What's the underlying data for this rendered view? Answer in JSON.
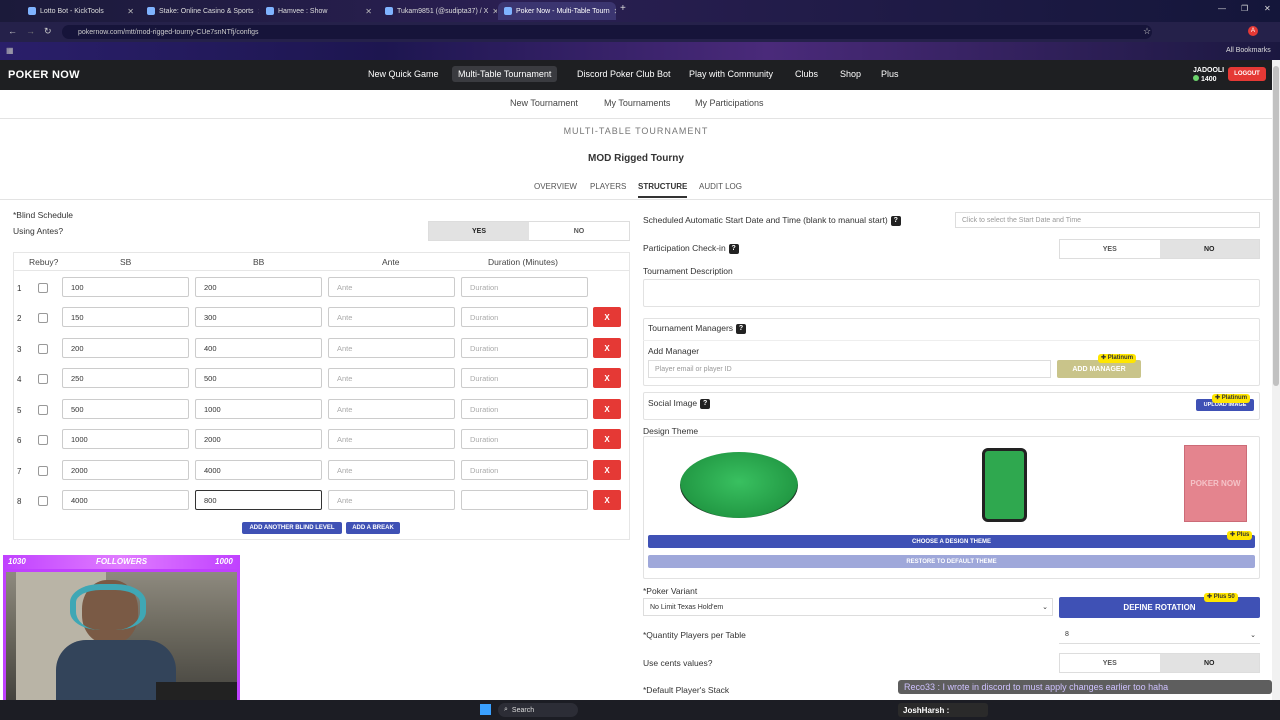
{
  "browser": {
    "tabs": [
      {
        "label": "Lotto Bot - KickTools"
      },
      {
        "label": "Stake: Online Casino & Sports"
      },
      {
        "label": "Hamvee : Show"
      },
      {
        "label": "Tukam9851 (@sudipta37) / X"
      },
      {
        "label": "Poker Now - Multi-Table Tourn"
      }
    ],
    "url": "pokernow.com/mtt/mod-rigged-tourny-CUe7snNTfj/configs",
    "bookmarks_label": "All Bookmarks"
  },
  "header": {
    "logo": "POKER NOW",
    "nav": [
      "New Quick Game",
      "Multi-Table Tournament",
      "Discord Poker Club Bot",
      "Play with Community",
      "Clubs",
      "Shop",
      "Plus"
    ],
    "username": "JADOOLI",
    "chips": "1400",
    "logout": "LOGOUT"
  },
  "subnav": [
    "New Tournament",
    "My Tournaments",
    "My Participations"
  ],
  "page": {
    "section": "MULTI-TABLE TOURNAMENT",
    "name": "MOD Rigged Tourny",
    "tabs": [
      "OVERVIEW",
      "PLAYERS",
      "STRUCTURE",
      "AUDIT LOG"
    ]
  },
  "blind": {
    "schedule_label": "*Blind Schedule",
    "antes_label": "Using Antes?",
    "yes": "YES",
    "no": "NO",
    "headers": [
      "Rebuy?",
      "SB",
      "BB",
      "Ante",
      "Duration (Minutes)"
    ],
    "ante_ph": "Ante",
    "duration_ph": "Duration",
    "rows": [
      {
        "n": "1",
        "sb": "100",
        "bb": "200"
      },
      {
        "n": "2",
        "sb": "150",
        "bb": "300"
      },
      {
        "n": "3",
        "sb": "200",
        "bb": "400"
      },
      {
        "n": "4",
        "sb": "250",
        "bb": "500"
      },
      {
        "n": "5",
        "sb": "500",
        "bb": "1000"
      },
      {
        "n": "6",
        "sb": "1000",
        "bb": "2000"
      },
      {
        "n": "7",
        "sb": "2000",
        "bb": "4000"
      },
      {
        "n": "8",
        "sb": "4000",
        "bb": "800"
      }
    ],
    "remove": "X",
    "add_level": "ADD ANOTHER BLIND LEVEL",
    "add_break": "ADD A BREAK"
  },
  "right": {
    "start_label": "Scheduled Automatic Start Date and Time (blank to manual start)",
    "start_ph": "Click to select the Start Date and Time",
    "checkin_label": "Participation Check-in",
    "desc_label": "Tournament Description",
    "managers_label": "Tournament Managers",
    "add_manager_label": "Add Manager",
    "manager_ph": "Player email or player ID",
    "add_manager_btn": "ADD MANAGER",
    "platinum": "Platinum",
    "social_label": "Social Image",
    "upload_btn": "UPLOAD IMAGE",
    "theme_label": "Design Theme",
    "card_logo": "POKER NOW",
    "choose_theme": "CHOOSE A DESIGN THEME",
    "restore_theme": "RESTORE TO DEFAULT THEME",
    "plus": "Plus",
    "variant_label": "*Poker Variant",
    "variant_value": "No Limit Texas Hold'em",
    "define_rotation": "DEFINE ROTATION",
    "plus_count": "50",
    "qty_label": "*Quantity Players per Table",
    "qty_value": "8",
    "cents_label": "Use cents values?",
    "stack_label": "*Default Player's Stack"
  },
  "overlay": {
    "followers_left": "1030",
    "followers_label": "FOLLOWERS",
    "followers_right": "1000",
    "chat": "Reco33 : I wrote in discord to must apply changes earlier too haha",
    "streamer": "JoshHarsh :",
    "taskbar_search": "Search"
  },
  "colors": {
    "accent": "#3f51b5",
    "danger": "#e53935",
    "felt": "#2fa84f",
    "purple": "#c041ff"
  }
}
